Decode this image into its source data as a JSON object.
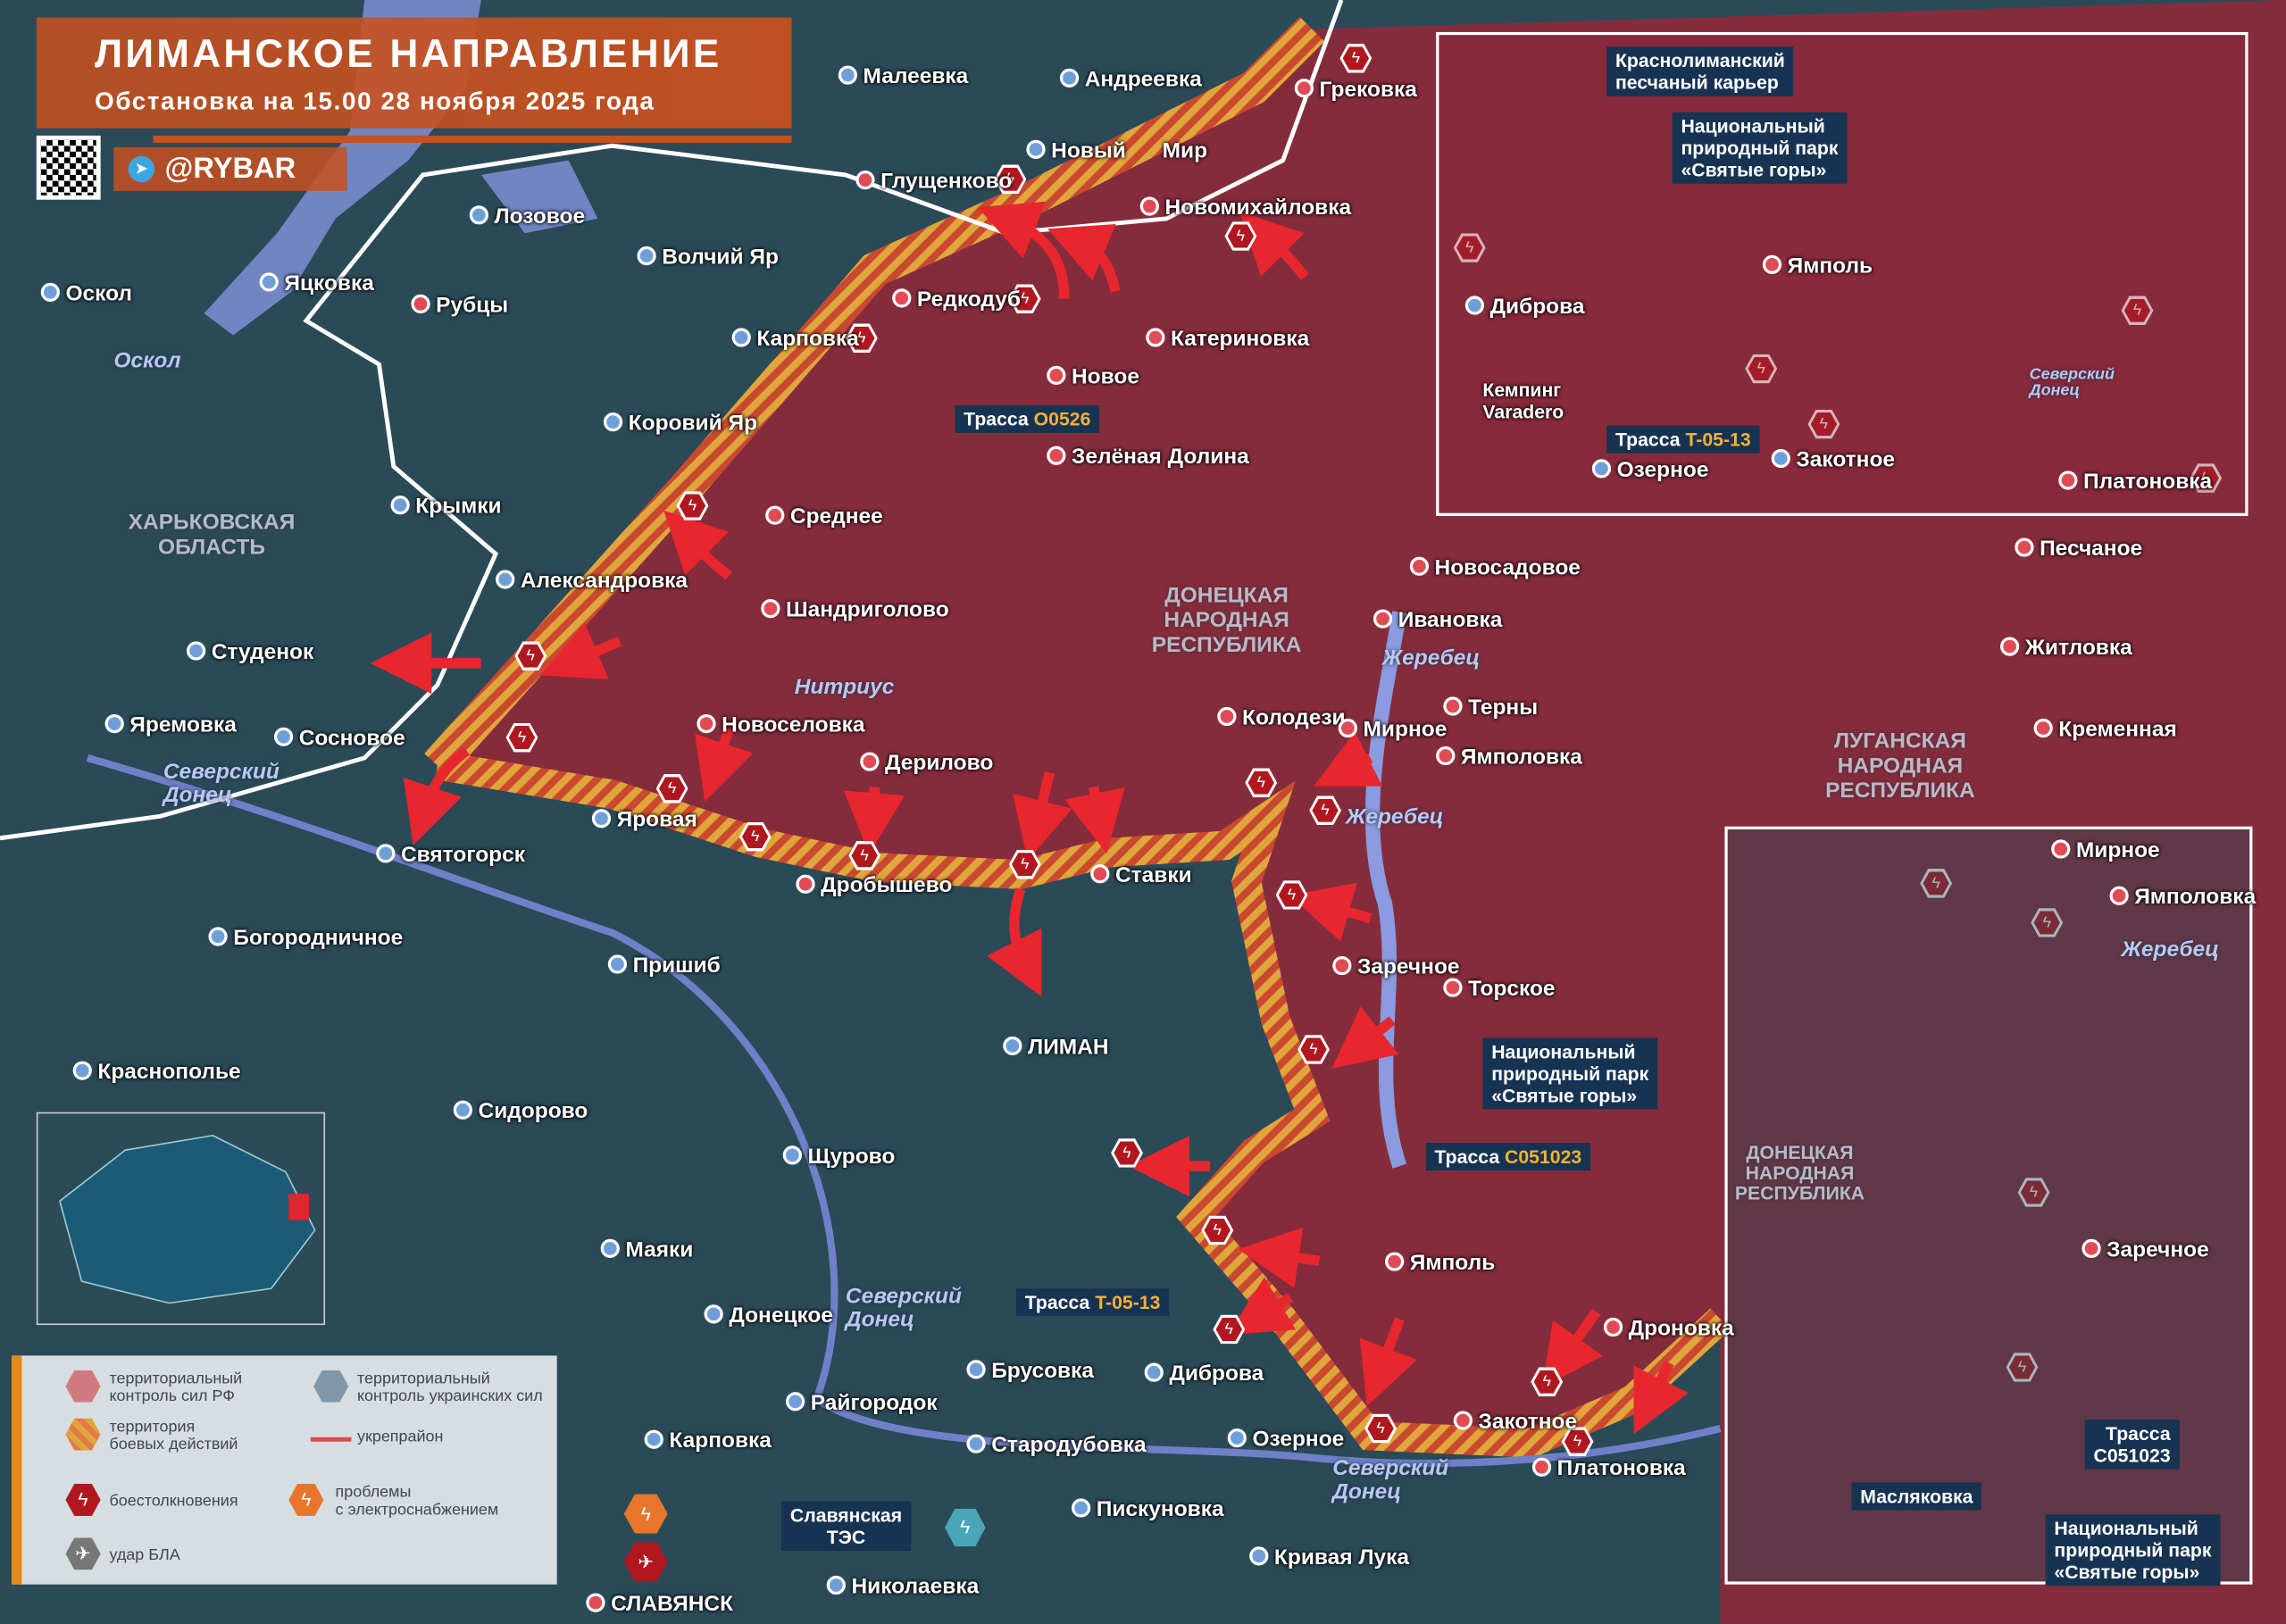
{
  "header": {
    "title": "ЛИМАНСКОЕ НАПРАВЛЕНИЕ",
    "subtitle": "Обстановка на 15.00 28 ноября 2025 года",
    "handle": "@RYBAR"
  },
  "colors": {
    "ru_control": "#8c2a3a",
    "ua_control": "#2b4a58",
    "combat": "#d9a13a",
    "clash": "#b0171f",
    "power": "#e8762a",
    "uav": "#777777",
    "fortification": "#e04b55",
    "water": "#7e8fd6",
    "title_bg": "#c8501e"
  },
  "legend": {
    "ru": "территориальный\nконтроль сил РФ",
    "ua": "территориальный\nконтроль украинских сил",
    "combat": "территория\nбоевых действий",
    "fort": "укрепрайон",
    "clash": "боестолкновения",
    "power": "проблемы\nс электроснабжением",
    "uav": "удар БЛА"
  },
  "places": [
    "Малеевка",
    "Андреевка",
    "Грековка",
    "Новый      Мир",
    "Глущенково",
    "Новомихайловка",
    "Лозовое",
    "Волчий Яр",
    "Оскол",
    "Яцковка",
    "Рубцы",
    "Редкодуб",
    "Карповка",
    "Катериновка",
    "Новое",
    "Коровий Яр",
    "Зелёная Долина",
    "Крымки",
    "Среднее",
    "Александровка",
    "Новосадовое",
    "Шандриголово",
    "Ивановка",
    "Студенок",
    "Терны",
    "Колодези",
    "Мирное",
    "Яремовка",
    "Новоселовка",
    "Сосновое",
    "Ямполовка",
    "Дерилово",
    "Яровая",
    "Святогорск",
    "Ставки",
    "Дробышево",
    "Богородничное",
    "Пришиб",
    "Заречное",
    "Торское",
    "ЛИМАН",
    "Краснополье",
    "Сидорово",
    "Щурово",
    "Маяки",
    "Ямполь",
    "Донецкое",
    "Дроновка",
    "Брусовка",
    "Диброва",
    "Райгородок",
    "Закотное",
    "Карповка",
    "Озерное",
    "Стародубовка",
    "Платоновка",
    "Пискуновка",
    "Кривая Лука",
    "Николаевка",
    "СЛАВЯНСК",
    "Песчаное",
    "Житловка",
    "Кременная"
  ],
  "rivers": [
    "Оскол",
    "Северский\nДонец",
    "Жеребец",
    "Нитриус",
    "Жеребец",
    "Северский\nДонец",
    "Северский\nДонец"
  ],
  "regions": [
    "ХАРЬКОВСКАЯ\nОБЛАСТЬ",
    "ДОНЕЦКАЯ\nНАРОДНАЯ\nРЕСПУБЛИКА",
    "ЛУГАНСКАЯ\nНАРОДНАЯ\nРЕСПУБЛИКА"
  ],
  "roads": {
    "o0526_prefix": "Трасса ",
    "o0526": "O0526",
    "c051023_prefix": "Трасса ",
    "c051023": "C051023",
    "t0513_prefix": "Трасса ",
    "t0513": "T-05-13"
  },
  "callouts": {
    "park": "Национальный\nприродный парк\n«Святые горы»",
    "tes": "Славянская\nТЭС"
  },
  "inset1": {
    "quarry": "Краснолиманский\nпесчаный карьер",
    "park": "Национальный\nприродный парк\n«Святые горы»",
    "places": [
      "Ямполь",
      "Диброва",
      "Озерное",
      "Закотное",
      "Платоновка"
    ],
    "camping": "Кемпинг\nVaradero",
    "road_prefix": "Трасса ",
    "road": "T-05-13",
    "river": "Северский\nДонец"
  },
  "inset2": {
    "places": [
      "Мирное",
      "Ямполовка",
      "Заречное",
      "Масляковка"
    ],
    "river": "Жеребец",
    "region": "ДОНЕЦКАЯ\nНАРОДНАЯ\nРЕСПУБЛИКА",
    "road": "Трасса\nC051023",
    "park": "Национальный\nприродный парк\n«Святые горы»"
  }
}
